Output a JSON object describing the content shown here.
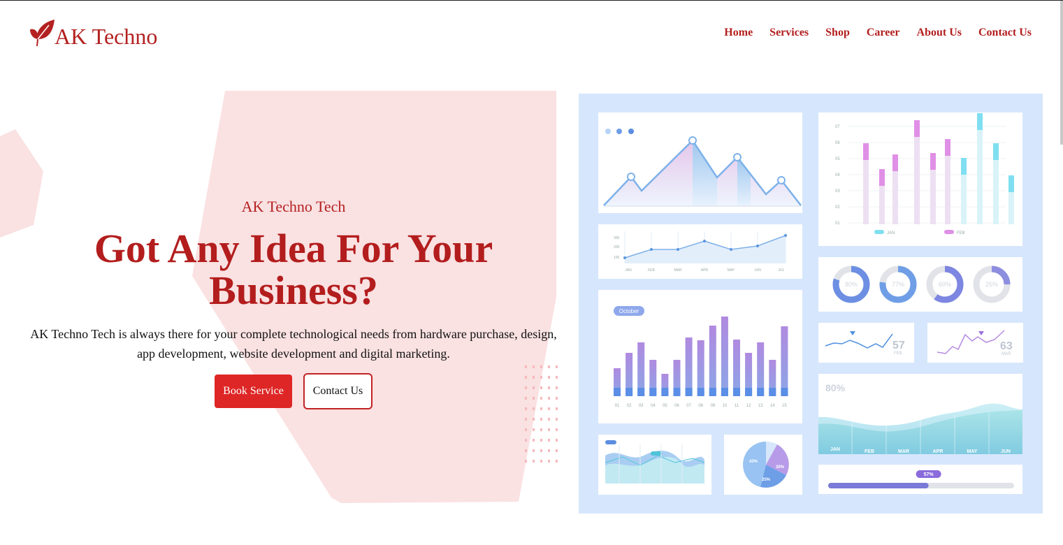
{
  "header": {
    "logo_text": "AK Techno",
    "nav": [
      "Home",
      "Services",
      "Shop",
      "Career",
      "About Us",
      "Contact Us"
    ]
  },
  "hero": {
    "eyebrow": "AK Techno Tech",
    "headline_line1": "Got Any Idea For Your",
    "headline_line2": "Business?",
    "description_line1": "AK Techno Tech is always there for your complete technological needs from hardware purchase, design,",
    "description_line2": "app development, website development and digital marketing.",
    "book_button": "Book Service",
    "contact_button": "Contact Us"
  },
  "colors": {
    "brand": "#b42121",
    "button_primary": "#de2626",
    "hero_shape": "#fae1e2",
    "dashboard_bg": "#d6e6fc"
  },
  "dashboard": {
    "line_chart_months": [
      "JAN",
      "FEB",
      "MAR",
      "APR",
      "MAY",
      "JUN",
      "JUL"
    ],
    "line_chart_yticks": [
      "300",
      "200",
      "100"
    ],
    "bar_chart_yticks": [
      "07",
      "06",
      "05",
      "04",
      "03",
      "02",
      "01"
    ],
    "bar_chart_legend": [
      "JAN",
      "FEB"
    ],
    "donut_values": [
      "80%",
      "77%",
      "60%",
      "25%"
    ],
    "big_bar_badge": "October",
    "big_bar_xticks": [
      "01",
      "02",
      "03",
      "04",
      "05",
      "06",
      "07",
      "08",
      "09",
      "10",
      "11",
      "12",
      "13",
      "14",
      "15"
    ],
    "sparkline1_value": "57",
    "sparkline1_label": "FEB",
    "sparkline2_value": "63",
    "sparkline2_label": "MAR",
    "wave_percent": "80%",
    "wave_months": [
      "JAN",
      "FEB",
      "MAR",
      "APR",
      "MAY",
      "JUN"
    ],
    "pie_values": [
      "43%",
      "30%",
      "25%"
    ],
    "progress_label": "57%",
    "progress_value": 0.54
  }
}
